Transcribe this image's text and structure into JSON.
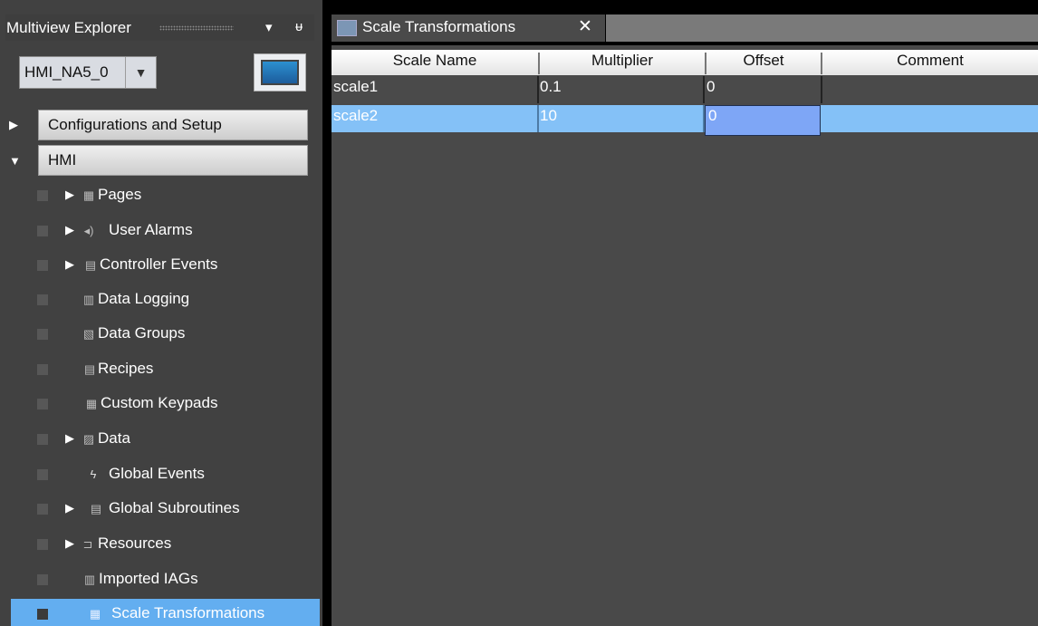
{
  "explorer": {
    "title": "Multiview Explorer",
    "device": "HMI_NA5_0",
    "sections": [
      {
        "label": "Configurations and Setup",
        "expanded": false
      },
      {
        "label": "HMI",
        "expanded": true
      }
    ],
    "items": [
      {
        "label": "Pages",
        "icon": "pages-icon",
        "expandable": true
      },
      {
        "label": "User Alarms",
        "icon": "speaker-icon",
        "expandable": true
      },
      {
        "label": "Controller Events",
        "icon": "calendar-icon",
        "expandable": true
      },
      {
        "label": "Data Logging",
        "icon": "data-logging-icon",
        "expandable": false
      },
      {
        "label": "Data Groups",
        "icon": "data-groups-icon",
        "expandable": false
      },
      {
        "label": "Recipes",
        "icon": "recipes-icon",
        "expandable": false
      },
      {
        "label": "Custom Keypads",
        "icon": "keypad-icon",
        "expandable": false
      },
      {
        "label": "Data",
        "icon": "data-icon",
        "expandable": true
      },
      {
        "label": "Global Events",
        "icon": "lightning-icon",
        "expandable": false
      },
      {
        "label": "Global Subroutines",
        "icon": "subroutine-icon",
        "expandable": true
      },
      {
        "label": "Resources",
        "icon": "resources-icon",
        "expandable": true
      },
      {
        "label": "Imported IAGs",
        "icon": "iag-icon",
        "expandable": false
      },
      {
        "label": "Scale Transformations",
        "icon": "scale-icon",
        "expandable": false,
        "selected": true
      }
    ]
  },
  "tab": {
    "label": "Scale Transformations",
    "close": "✕"
  },
  "table": {
    "columns": [
      "Scale Name",
      "Multiplier",
      "Offset",
      "Comment"
    ],
    "rows": [
      {
        "name": "scale1",
        "multiplier": "0.1",
        "offset": "0",
        "comment": ""
      },
      {
        "name": "scale2",
        "multiplier": "10",
        "offset": "0",
        "comment": "",
        "selected": true
      }
    ]
  },
  "colors": {
    "selection": "#63aef0",
    "row_selected": "#84c1f7",
    "panel": "#414141",
    "editor": "#494949"
  }
}
